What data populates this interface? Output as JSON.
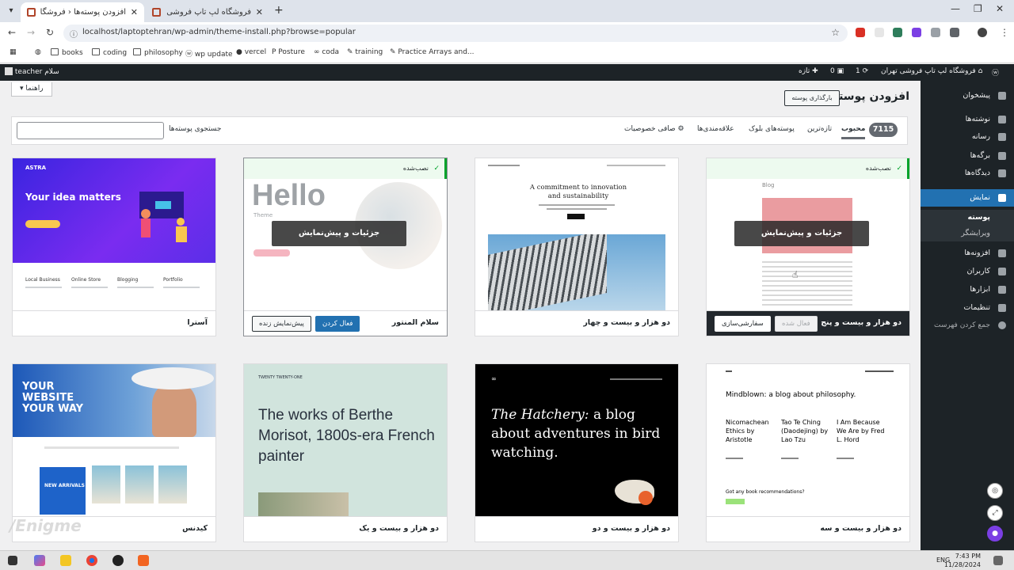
{
  "browser": {
    "tabs": [
      {
        "title": "افزودن پوسته‌ها ‹ فروشگاه لپ تاپ",
        "active": true
      },
      {
        "title": "فروشگاه لپ تاپ فروشی تهران",
        "active": false
      }
    ],
    "url": "localhost/laptoptehran/wp-admin/theme-install.php?browse=popular",
    "bookmarks": [
      "books",
      "coding",
      "philosophy",
      "wp update",
      "vercel",
      "Posture",
      "coda",
      "training",
      "Practice Arrays and..."
    ]
  },
  "adminbar": {
    "site_name": "فروشگاه لپ تاپ فروشی تهران",
    "updates": "1",
    "comments": "0",
    "new": "تازه",
    "greeting": "سلام",
    "user": "teacher"
  },
  "sidebar": {
    "items": [
      {
        "label": "پیشخوان"
      },
      {
        "label": "نوشته‌ها"
      },
      {
        "label": "رسانه"
      },
      {
        "label": "برگه‌ها"
      },
      {
        "label": "دیدگاه‌ها"
      },
      {
        "label": "نمایش"
      },
      {
        "label": "افزونه‌ها"
      },
      {
        "label": "کاربران"
      },
      {
        "label": "ابزارها"
      },
      {
        "label": "تنظیمات"
      }
    ],
    "submenu": [
      {
        "label": "پوسته"
      },
      {
        "label": "ویرایشگر"
      }
    ],
    "collapse": "جمع کردن فهرست"
  },
  "page": {
    "help": "راهنما",
    "title": "افزودن پوسته‌ها",
    "upload": "بارگذاری پوسته"
  },
  "filter": {
    "count": "7115",
    "tabs": [
      "محبوب",
      "تازه‌ترین",
      "پوسته‌های بلوک",
      "علاقه‌مندی‌ها",
      "صافی خصوصیات"
    ],
    "search_label": "جستجوی پوسته‌ها"
  },
  "themes": [
    {
      "name": "آسترا",
      "installed": false
    },
    {
      "name": "سلام المنتور",
      "installed": true,
      "installed_label": "نصب‌شده",
      "details": "جزئیات و پیش‌نمایش",
      "activate": "فعال کردن",
      "preview": "پیش‌نمایش زنده"
    },
    {
      "name": "دو هزار و بیست و چهار",
      "installed": false
    },
    {
      "name": "دو هزار و بیست و پنج",
      "installed": true,
      "installed_label": "نصب‌شده",
      "details": "جزئیات و پیش‌نمایش",
      "activate": "فعال شده",
      "customize": "سفارشی‌سازی"
    },
    {
      "name": "کیدنس",
      "installed": false
    },
    {
      "name": "دو هزار و بیست و یک",
      "installed": false
    },
    {
      "name": "دو هزار و بیست و دو",
      "installed": false
    },
    {
      "name": "دو هزار و بیست و سه",
      "installed": false
    }
  ],
  "screenshots": {
    "astra": {
      "logo": "ASTRA",
      "headline": "Your idea matters",
      "features": [
        "Local Business",
        "Online Store",
        "Blogging",
        "Portfolio"
      ]
    },
    "hello": {
      "headline": "Hello",
      "sub": "Theme"
    },
    "tt24": {
      "headline": "A commitment to innovation and sustainability"
    },
    "tt25": {
      "label": "Blog"
    },
    "kadence": {
      "headline": "YOUR WEBSITE YOUR WAY",
      "badge": "NEW ARRIVALS"
    },
    "tt21": {
      "site": "TWENTY TWENTY-ONE",
      "headline": "The works of Berthe Morisot, 1800s-era French painter"
    },
    "tt22": {
      "headline_em": "The Hatchery:",
      "headline_rest": " a blog about adventures in bird watching."
    },
    "tt23": {
      "headline": "Mindblown: a blog about philosophy.",
      "cols": [
        "Nicomachean Ethics by Aristotle",
        "Tao Te Ching (Daodejing) by Lao Tzu",
        "I Am Because We Are by Fred L. Hord"
      ],
      "question": "Got any book recommendations?"
    }
  },
  "watermark": "/Enigme",
  "taskbar": {
    "lang": "ENG",
    "time": "7:43 PM",
    "date": "11/28/2024"
  }
}
